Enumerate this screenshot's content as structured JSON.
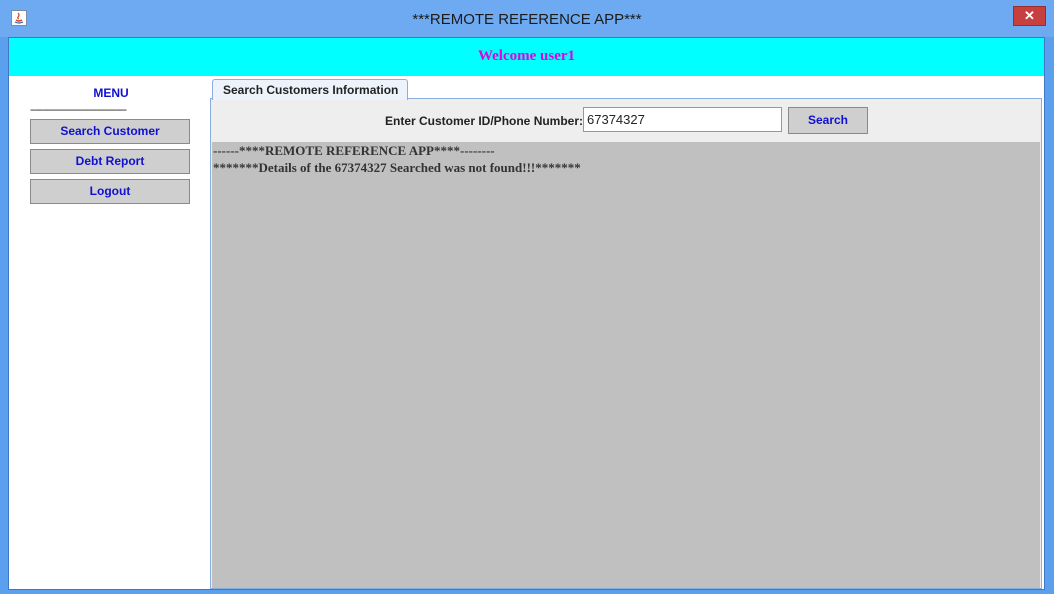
{
  "window": {
    "title": "***REMOTE REFERENCE APP***",
    "close_label": "✕"
  },
  "header": {
    "welcome": "Welcome user1"
  },
  "menu": {
    "title": "MENU",
    "divider": "------------------------------------",
    "items": [
      {
        "label": "Search Customer"
      },
      {
        "label": "Debt Report"
      },
      {
        "label": "Logout"
      }
    ]
  },
  "tabs": [
    {
      "label": "Search Customers Information",
      "active": true
    }
  ],
  "search": {
    "label": "Enter Customer ID/Phone Number:",
    "value": "67374327",
    "button_label": "Search"
  },
  "results": {
    "lines": [
      "------****REMOTE REFERENCE APP****--------",
      "*******Details of the 67374327 Searched was not found!!!*******"
    ]
  },
  "colors": {
    "header_bg": "#00ffff",
    "welcome_text": "#e000e0",
    "button_text": "#1010d0",
    "results_bg": "#c0c0c0"
  }
}
